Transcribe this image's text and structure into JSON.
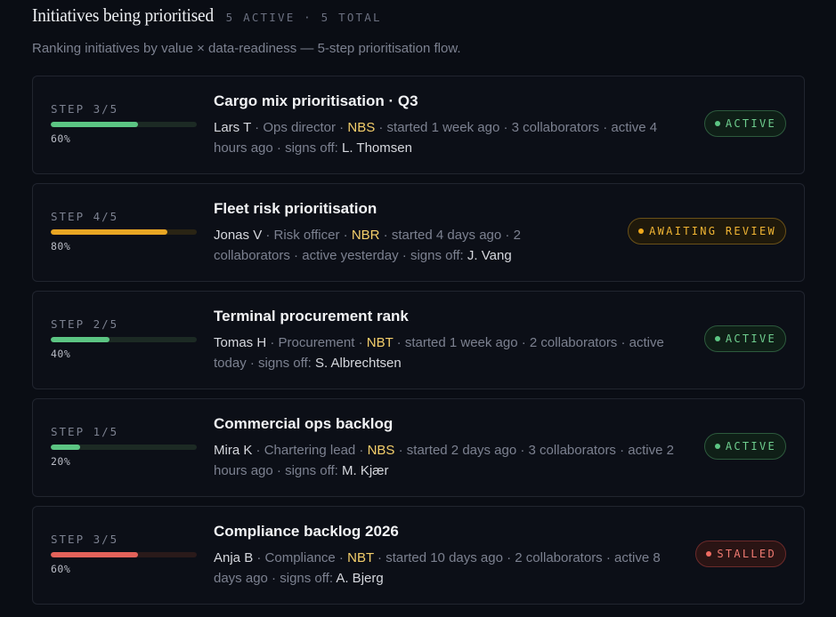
{
  "header": {
    "title": "Initiatives being prioritised",
    "counts": "5 ACTIVE · 5 TOTAL",
    "subtitle": "Ranking initiatives by value × data-readiness — 5-step prioritisation flow."
  },
  "colors": {
    "active": "#5cc583",
    "awaiting_review": "#e9a623",
    "stalled": "#e4625a",
    "code_highlight": "#f5cf6b"
  },
  "initiatives": [
    {
      "step_label": "STEP 3/5",
      "progress": 0.6,
      "progress_label": "60%",
      "status": "active",
      "name": "Cargo mix prioritisation · Q3",
      "owner": "Lars T",
      "role": "Ops director",
      "code": "NBS",
      "started": "started 1 week ago",
      "collaborators": "3 collaborators",
      "activity": "active 4 hours ago",
      "signs_off_label": "signs off:",
      "approver": "L. Thomsen",
      "badge": "ACTIVE"
    },
    {
      "step_label": "STEP 4/5",
      "progress": 0.8,
      "progress_label": "80%",
      "status": "review",
      "name": "Fleet risk prioritisation",
      "owner": "Jonas V",
      "role": "Risk officer",
      "code": "NBR",
      "started": "started 4 days ago",
      "collaborators": "2 collaborators",
      "activity": "active yesterday",
      "signs_off_label": "signs off:",
      "approver": "J. Vang",
      "badge": "AWAITING REVIEW"
    },
    {
      "step_label": "STEP 2/5",
      "progress": 0.4,
      "progress_label": "40%",
      "status": "active",
      "name": "Terminal procurement rank",
      "owner": "Tomas H",
      "role": "Procurement",
      "code": "NBT",
      "started": "started 1 week ago",
      "collaborators": "2 collaborators",
      "activity": "active today",
      "signs_off_label": "signs off:",
      "approver": "S. Albrechtsen",
      "badge": "ACTIVE"
    },
    {
      "step_label": "STEP 1/5",
      "progress": 0.2,
      "progress_label": "20%",
      "status": "active",
      "name": "Commercial ops backlog",
      "owner": "Mira K",
      "role": "Chartering lead",
      "code": "NBS",
      "started": "started 2 days ago",
      "collaborators": "3 collaborators",
      "activity": "active 2 hours ago",
      "signs_off_label": "signs off:",
      "approver": "M. Kjær",
      "badge": "ACTIVE"
    },
    {
      "step_label": "STEP 3/5",
      "progress": 0.6,
      "progress_label": "60%",
      "status": "stalled",
      "name": "Compliance backlog 2026",
      "owner": "Anja B",
      "role": "Compliance",
      "code": "NBT",
      "started": "started 10 days ago",
      "collaborators": "2 collaborators",
      "activity": "active 8 days ago",
      "signs_off_label": "signs off:",
      "approver": "A. Bjerg",
      "badge": "STALLED"
    }
  ]
}
